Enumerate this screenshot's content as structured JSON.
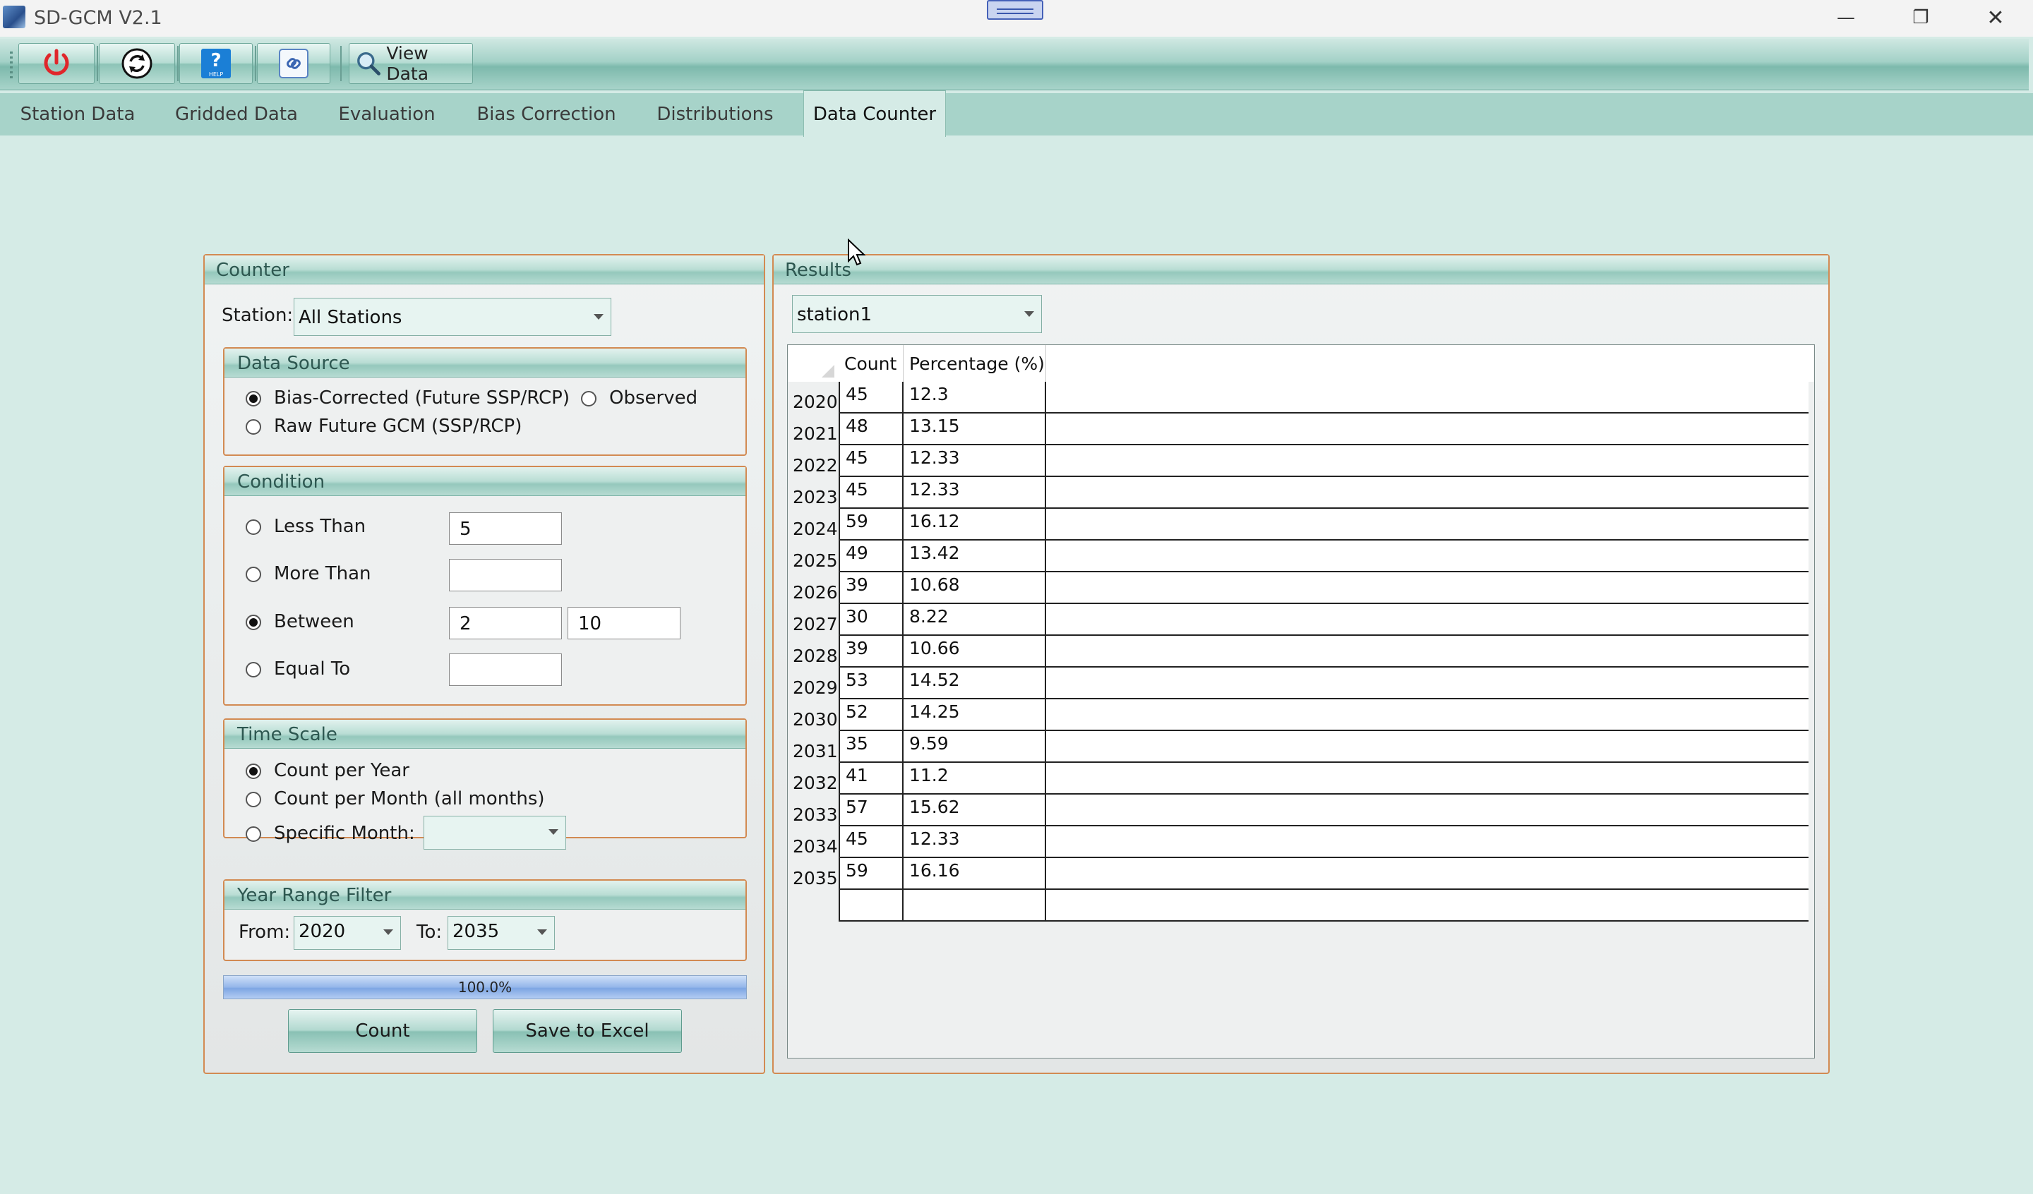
{
  "window": {
    "title": "SD-GCM V2.1",
    "minimize_glyph": "—",
    "restore_glyph": "❐",
    "close_glyph": "✕"
  },
  "toolbar": {
    "icons": [
      "power-icon",
      "refresh-icon",
      "help-icon",
      "link-icon",
      "magnifier-icon"
    ],
    "help_icon_text": "?",
    "help_icon_caption": "HELP",
    "view_data_label": "View Data"
  },
  "tabs": [
    {
      "label": "Station Data"
    },
    {
      "label": "Gridded Data"
    },
    {
      "label": "Evaluation"
    },
    {
      "label": "Bias Correction"
    },
    {
      "label": "Distributions"
    },
    {
      "label": "Data Counter",
      "active": true
    }
  ],
  "counter": {
    "title": "Counter",
    "station_label": "Station:",
    "station_value": "All Stations",
    "data_source": {
      "title": "Data Source",
      "options": [
        {
          "label": "Bias-Corrected (Future SSP/RCP)",
          "selected": true
        },
        {
          "label": "Observed",
          "selected": false
        },
        {
          "label": "Raw Future GCM (SSP/RCP)",
          "selected": false
        }
      ]
    },
    "condition": {
      "title": "Condition",
      "less_than": {
        "label": "Less Than",
        "value": "5",
        "selected": false
      },
      "more_than": {
        "label": "More Than",
        "value": "",
        "selected": false
      },
      "between": {
        "label": "Between",
        "min": "2",
        "max": "10",
        "selected": true
      },
      "equal_to": {
        "label": "Equal To",
        "value": "",
        "selected": false
      }
    },
    "time_scale": {
      "title": "Time Scale",
      "options": [
        {
          "label": "Count per Year",
          "selected": true
        },
        {
          "label": "Count per Month (all months)",
          "selected": false
        },
        {
          "label": "Specific Month:",
          "selected": false
        }
      ],
      "month_value": ""
    },
    "year_range": {
      "title": "Year Range Filter",
      "from_label": "From:",
      "from_value": "2020",
      "to_label": "To:",
      "to_value": "2035"
    },
    "progress": {
      "fraction": 1.0,
      "text": "100.0%"
    },
    "count_button": "Count",
    "save_button": "Save to Excel"
  },
  "results": {
    "title": "Results",
    "station_value": "station1",
    "columns": [
      "Count",
      "Percentage (%)"
    ],
    "rows": [
      {
        "year": "2020",
        "count": "45",
        "pct": "12.3"
      },
      {
        "year": "2021",
        "count": "48",
        "pct": "13.15"
      },
      {
        "year": "2022",
        "count": "45",
        "pct": "12.33"
      },
      {
        "year": "2023",
        "count": "45",
        "pct": "12.33"
      },
      {
        "year": "2024",
        "count": "59",
        "pct": "16.12"
      },
      {
        "year": "2025",
        "count": "49",
        "pct": "13.42"
      },
      {
        "year": "2026",
        "count": "39",
        "pct": "10.68"
      },
      {
        "year": "2027",
        "count": "30",
        "pct": "8.22"
      },
      {
        "year": "2028",
        "count": "39",
        "pct": "10.66"
      },
      {
        "year": "2029",
        "count": "53",
        "pct": "14.52"
      },
      {
        "year": "2030",
        "count": "52",
        "pct": "14.25"
      },
      {
        "year": "2031",
        "count": "35",
        "pct": "9.59"
      },
      {
        "year": "2032",
        "count": "41",
        "pct": "11.2"
      },
      {
        "year": "2033",
        "count": "57",
        "pct": "15.62"
      },
      {
        "year": "2034",
        "count": "45",
        "pct": "12.33"
      },
      {
        "year": "2035",
        "count": "59",
        "pct": "16.16"
      }
    ]
  },
  "colors": {
    "background": "#d5ebe6",
    "panel_border": "#d28a52",
    "header_teal": "#95c8bc",
    "progress_blue": "#7ea6e3",
    "power_red": "#e0262b"
  }
}
